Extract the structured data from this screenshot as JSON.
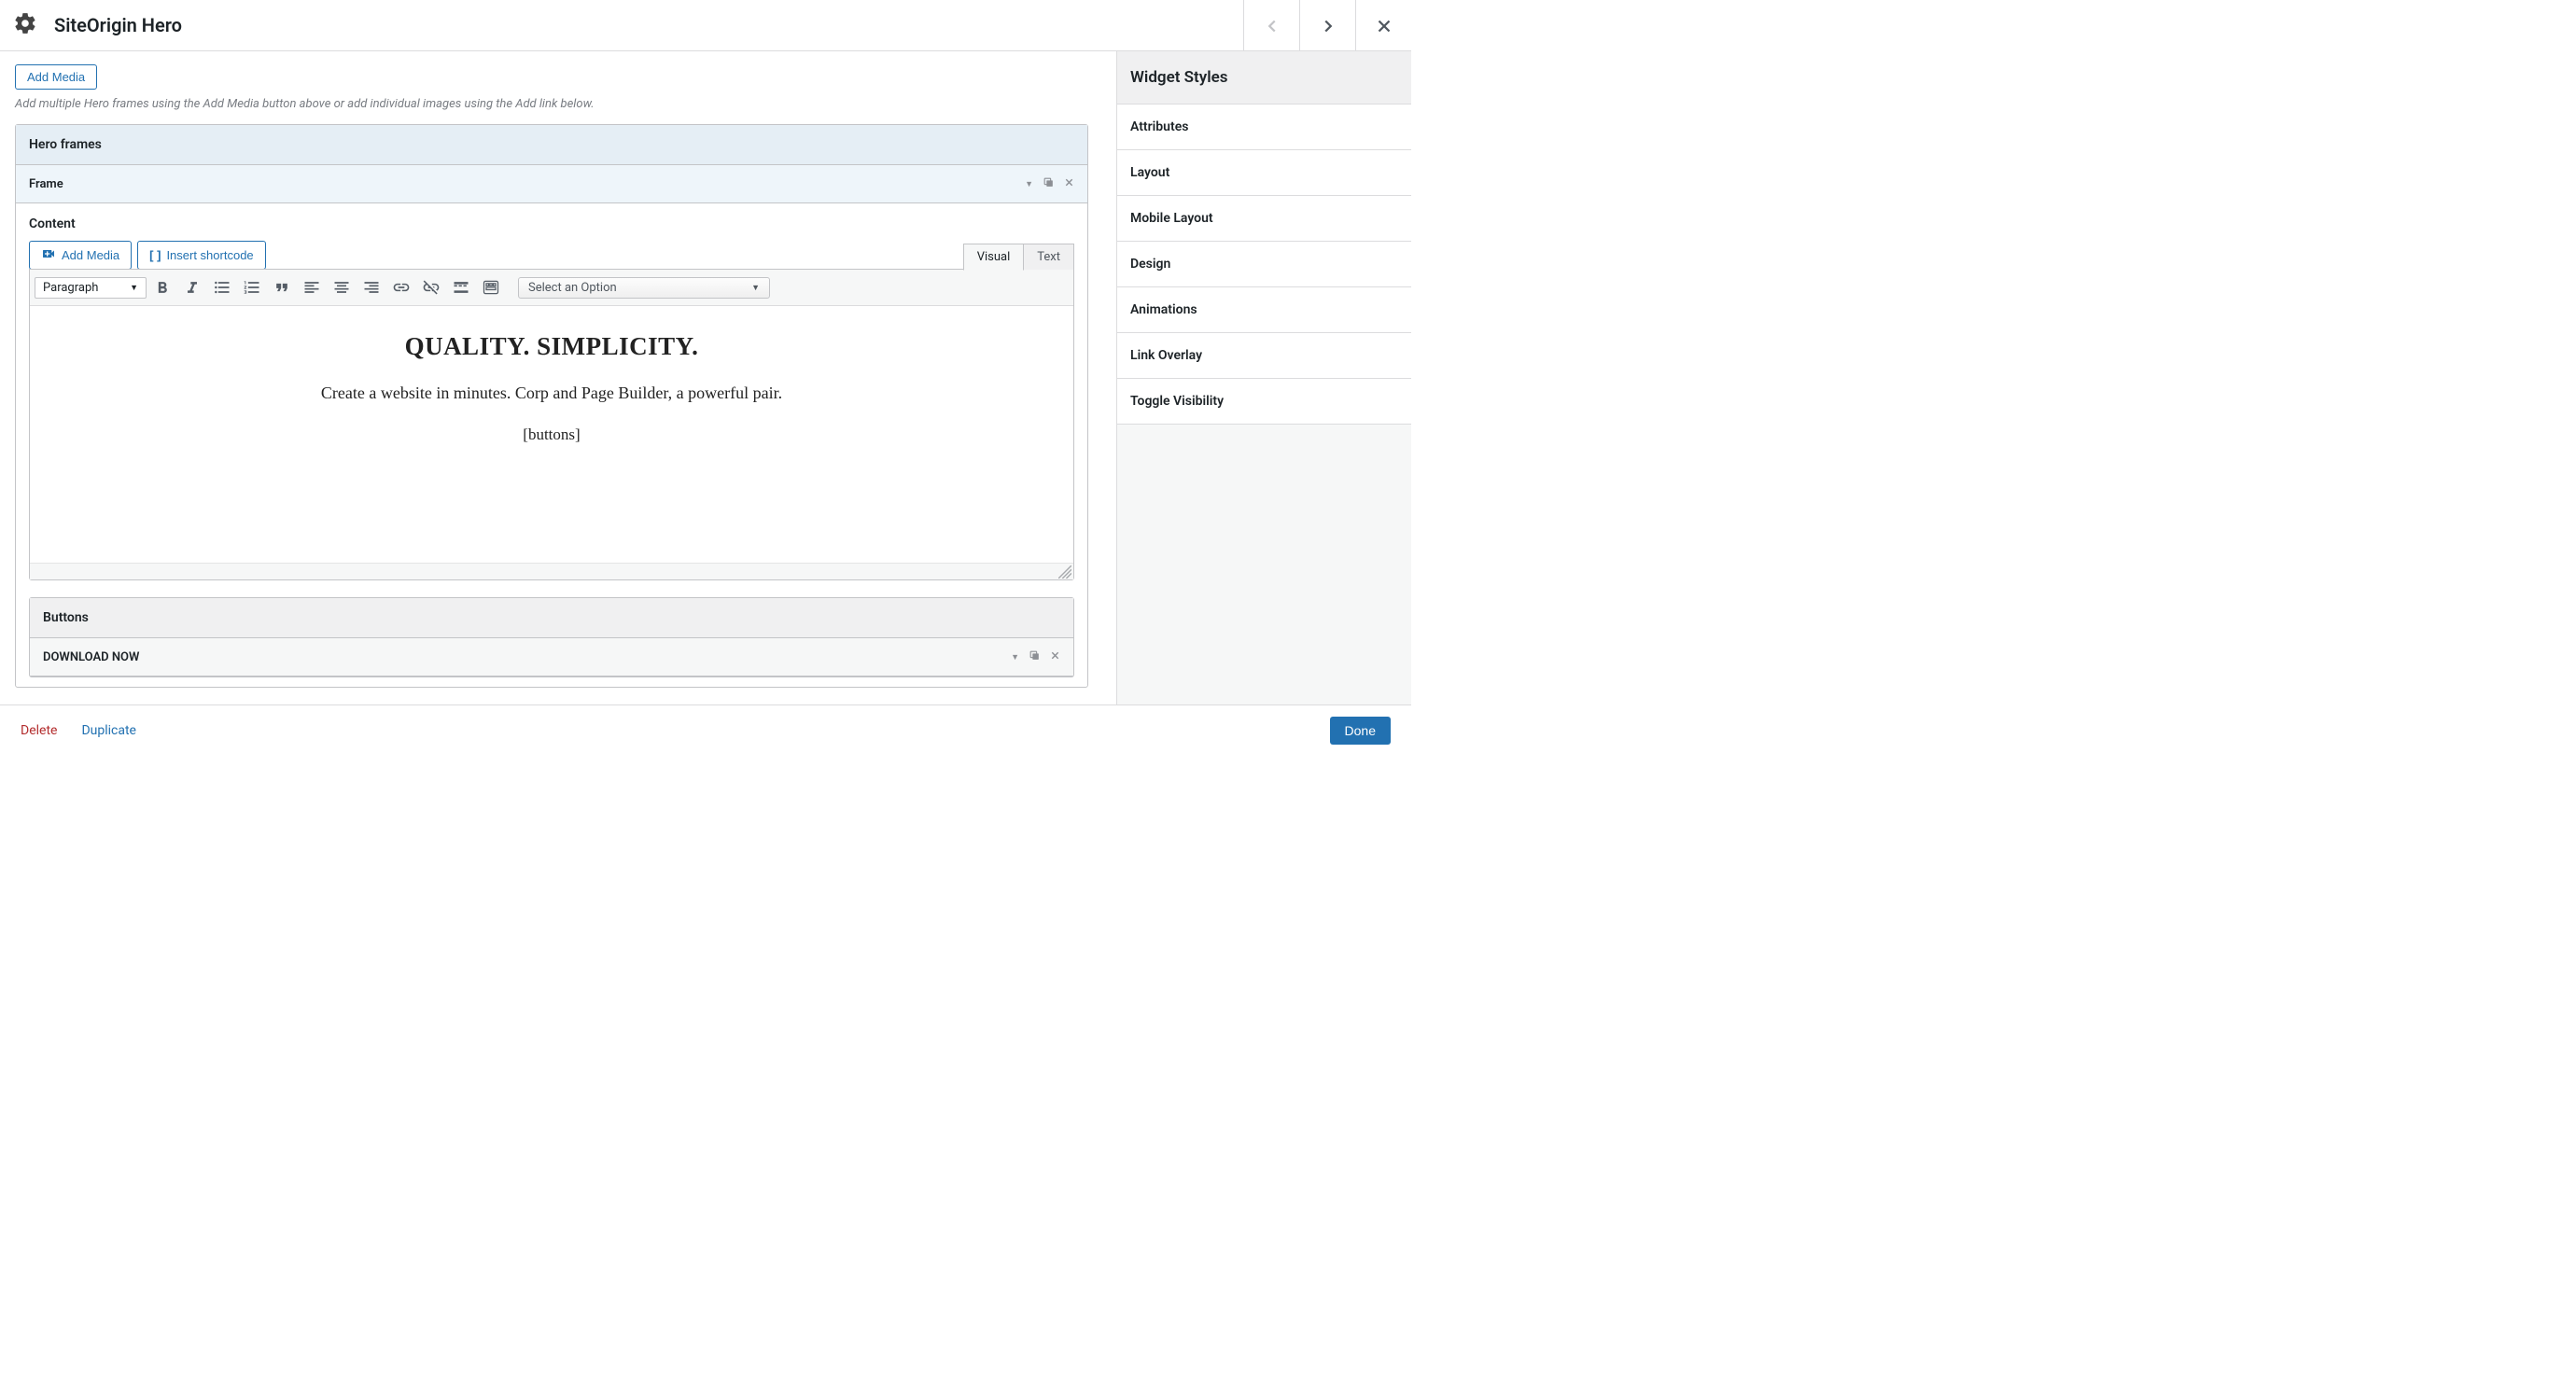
{
  "header": {
    "title": "SiteOrigin Hero"
  },
  "main": {
    "add_media_btn": "Add Media",
    "help": "Add multiple Hero frames using the Add Media button above or add individual images using the Add link below.",
    "hero_frames_label": "Hero frames",
    "frame_label": "Frame",
    "content_label": "Content",
    "add_media_btn2": "Add Media",
    "insert_shortcode_btn": "Insert shortcode",
    "tab_visual": "Visual",
    "tab_text": "Text",
    "format_select": "Paragraph",
    "option_select": "Select an Option",
    "editor_heading": "QUALITY. SIMPLICITY.",
    "editor_text": "Create a website in minutes. Corp and Page Builder, a powerful pair.",
    "editor_shortcode": "[buttons]",
    "buttons_label": "Buttons",
    "button_item_label": "DOWNLOAD NOW"
  },
  "sidebar": {
    "title": "Widget Styles",
    "rows": [
      "Attributes",
      "Layout",
      "Mobile Layout",
      "Design",
      "Animations",
      "Link Overlay",
      "Toggle Visibility"
    ]
  },
  "footer": {
    "delete": "Delete",
    "duplicate": "Duplicate",
    "done": "Done"
  }
}
